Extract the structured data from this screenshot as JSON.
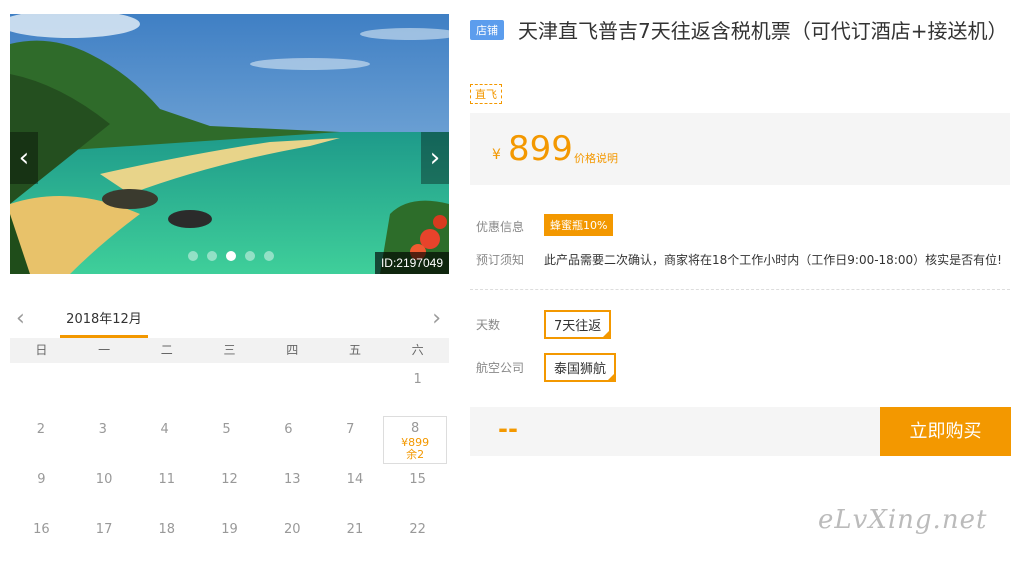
{
  "gallery": {
    "prev_symbol": "‹",
    "next_symbol": "›",
    "image_id": "ID:2197049",
    "dot_count": 5,
    "active_dot": 2
  },
  "calendar": {
    "month": "2018年12月",
    "prev_symbol": "‹",
    "next_symbol": "›",
    "weekdays": [
      "日",
      "一",
      "二",
      "三",
      "四",
      "五",
      "六"
    ],
    "rows": [
      [
        "",
        "",
        "",
        "",
        "",
        "",
        "1"
      ],
      [
        "2",
        "3",
        "4",
        "5",
        "6",
        "7",
        "8"
      ],
      [
        "9",
        "10",
        "11",
        "12",
        "13",
        "14",
        "15"
      ],
      [
        "16",
        "17",
        "18",
        "19",
        "20",
        "21",
        "22"
      ]
    ],
    "available": {
      "day": "8",
      "price": "¥899",
      "remaining": "余2"
    }
  },
  "product": {
    "store_badge": "店铺",
    "title": "天津直飞普吉7天往返含税机票（可代订酒店+接送机）",
    "tag": "直飞",
    "price_symbol": "¥",
    "price": "899",
    "price_note": "价格说明"
  },
  "info": {
    "promo_label": "优惠信息",
    "promo_badge": "蜂蜜瓶10%",
    "notice_label": "预订须知",
    "notice_text": "此产品需要二次确认，商家将在18个工作小时内（工作日9:00-18:00）核实是否有位!"
  },
  "options": {
    "days_label": "天数",
    "days_value": "7天往返",
    "airline_label": "航空公司",
    "airline_value": "泰国狮航"
  },
  "purchase": {
    "total": "--",
    "buy_label": "立即购买"
  },
  "watermark": "eLvXing.net",
  "colors": {
    "accent": "#f39800",
    "store_badge": "#5c9ded"
  }
}
